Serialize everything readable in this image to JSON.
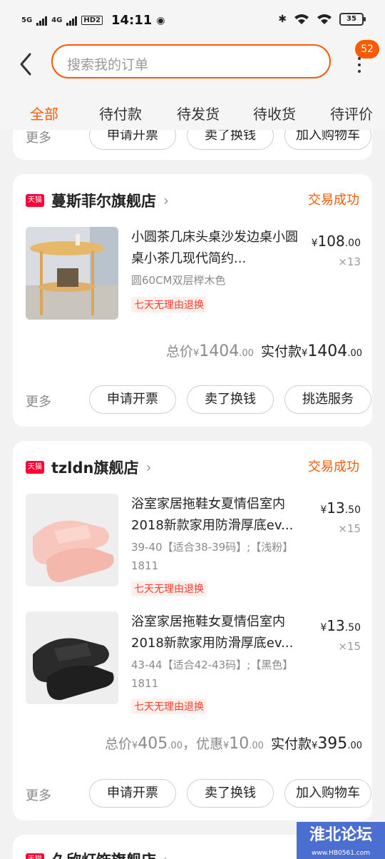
{
  "status_bar": {
    "sim1": "5G",
    "sim2": "4G",
    "hd": "HD2",
    "time": "14:11",
    "battery": "35"
  },
  "header": {
    "search_placeholder": "搜索我的订单",
    "badge_count": "52"
  },
  "tabs": [
    "全部",
    "待付款",
    "待发货",
    "待收货",
    "待评价"
  ],
  "partial_top_card": {
    "more": "更多",
    "buttons": [
      "申请开票",
      "卖了换钱",
      "加入购物车"
    ]
  },
  "orders": [
    {
      "badge": "天猫",
      "store": "蔓斯菲尔旗舰店",
      "status": "交易成功",
      "items": [
        {
          "title": "小圆茶几床头桌沙发边桌小圆桌小茶几现代简约...",
          "sku": "圆60CM双层榉木色",
          "tag": "七天无理由退换",
          "price_int": "108",
          "price_dec": ".00",
          "qty": "×13"
        }
      ],
      "total_label": "总价",
      "total_int": "1404",
      "total_dec": ".00",
      "paid_label": "实付款",
      "paid_int": "1404",
      "paid_dec": ".00",
      "more": "更多",
      "buttons": [
        "申请开票",
        "卖了换钱",
        "挑选服务"
      ]
    },
    {
      "badge": "天猫",
      "store": "tzldn旗舰店",
      "status": "交易成功",
      "items": [
        {
          "title": "浴室家居拖鞋女夏情侣室内2018新款家用防滑厚底ev...",
          "sku": "39-40【适合38-39码】;【浅粉】1811",
          "tag": "七天无理由退换",
          "price_int": "13",
          "price_dec": ".50",
          "qty": "×15"
        },
        {
          "title": "浴室家居拖鞋女夏情侣室内2018新款家用防滑厚底ev...",
          "sku": "43-44【适合42-43码】;【黑色】1811",
          "tag": "七天无理由退换",
          "price_int": "13",
          "price_dec": ".50",
          "qty": "×15"
        }
      ],
      "total_label": "总价",
      "total_int": "405",
      "total_dec": ".00",
      "discount_label": "，优惠",
      "discount_int": "10",
      "discount_dec": ".00",
      "paid_label": "实付款",
      "paid_int": "395",
      "paid_dec": ".00",
      "more": "更多",
      "buttons": [
        "申请开票",
        "卖了换钱",
        "加入购物车"
      ]
    },
    {
      "badge": "天猫",
      "store": "久欣灯饰旗舰店"
    }
  ],
  "currency": "¥",
  "watermark": {
    "title": "淮北论坛",
    "url": "www.HB0561.com"
  }
}
